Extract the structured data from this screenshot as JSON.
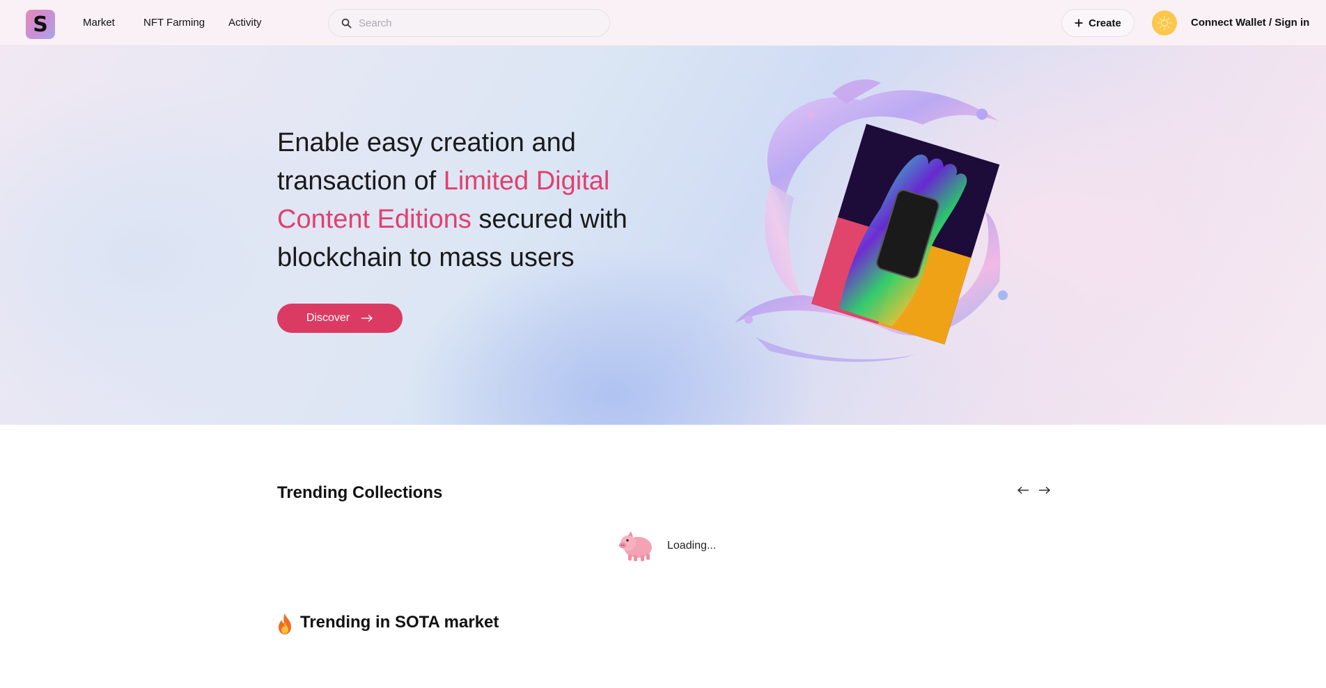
{
  "header": {
    "logo_letter": "S",
    "nav": [
      {
        "label": "Market"
      },
      {
        "label": "NFT Farming"
      },
      {
        "label": "Activity"
      }
    ],
    "search": {
      "placeholder": "Search",
      "value": "",
      "icon": "search-icon"
    },
    "create_label": "Create",
    "create_icon": "plus-icon",
    "theme_icon": "sun-icon",
    "connect_label": "Connect Wallet / Sign in"
  },
  "hero": {
    "title_part1": "Enable easy creation and transaction of ",
    "title_highlight": "Limited Digital Content Editions",
    "title_part2": " secured with blockchain to mass users",
    "highlight_color": "#e0406f",
    "discover_label": "Discover",
    "discover_icon": "arrow-right-icon",
    "art_icon": "hand-phone-liquid-art"
  },
  "trending_collections": {
    "title": "Trending Collections",
    "prev_icon": "arrow-left-icon",
    "next_icon": "arrow-right-icon",
    "loading_text": "Loading...",
    "loading_icon": "pig-icon"
  },
  "trending_market": {
    "title": "Trending in SOTA market",
    "icon": "fire-icon"
  },
  "colors": {
    "accent": "#db3a62",
    "header_bg": "#f9f1f6",
    "theme_toggle": "#fcc74a"
  }
}
